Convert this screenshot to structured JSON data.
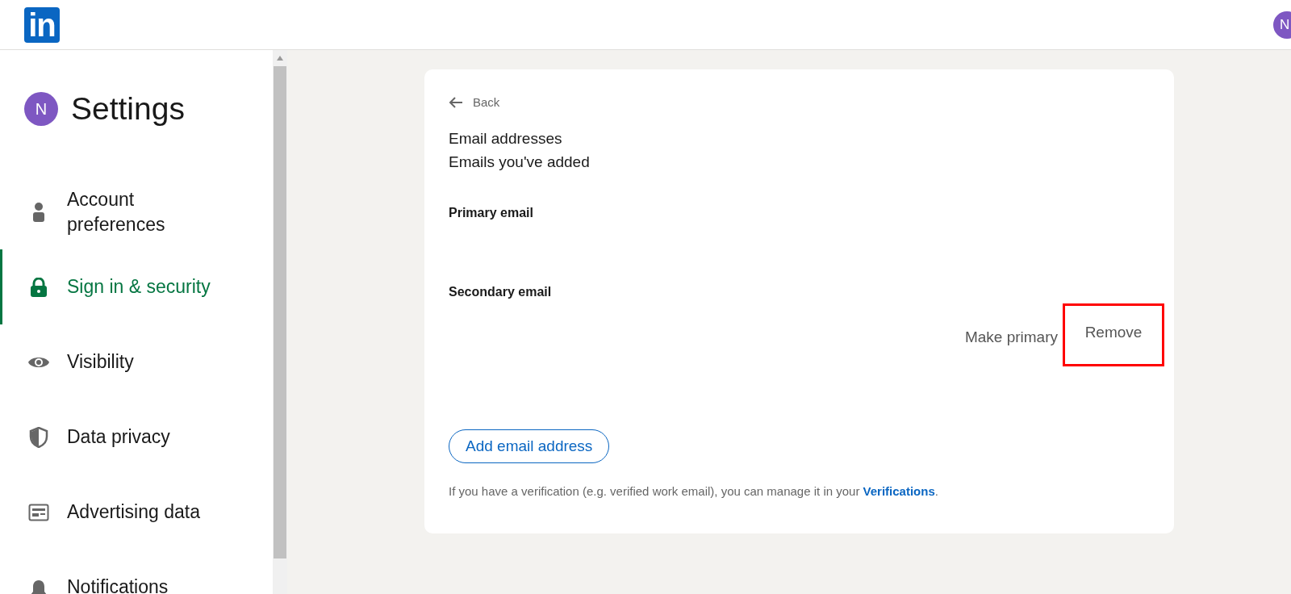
{
  "header": {
    "logo": "in",
    "avatar_initial": "N"
  },
  "sidebar": {
    "avatar_initial": "N",
    "title": "Settings",
    "items": [
      {
        "kind": "person",
        "label": "Account preferences",
        "selected": false
      },
      {
        "kind": "lock",
        "label": "Sign in & security",
        "selected": true
      },
      {
        "kind": "eye",
        "label": "Visibility",
        "selected": false
      },
      {
        "kind": "shield",
        "label": "Data privacy",
        "selected": false
      },
      {
        "kind": "ad",
        "label": "Advertising data",
        "selected": false
      },
      {
        "kind": "bell",
        "label": "Notifications",
        "selected": false
      }
    ]
  },
  "card": {
    "back": "Back",
    "title": "Email addresses",
    "subtitle": "Emails you've added",
    "sections": [
      {
        "heading": "Primary email"
      },
      {
        "heading": "Secondary email",
        "actions": [
          {
            "label": "Make primary",
            "highlighted": false
          },
          {
            "label": "Remove",
            "highlighted": true
          }
        ]
      }
    ],
    "add_button": "Add email address",
    "footer_text": "If you have a verification (e.g. verified work email), you can manage it in your ",
    "footer_link": "Verifications",
    "footer_end": "."
  }
}
